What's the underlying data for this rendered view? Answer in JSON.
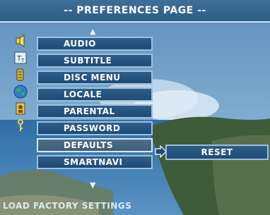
{
  "header": {
    "title": "-- PREFERENCES PAGE --"
  },
  "arrows": {
    "up": "▲",
    "down": "▼"
  },
  "menu": {
    "items": [
      {
        "label": "AUDIO",
        "icon": "speaker-icon"
      },
      {
        "label": "SUBTITLE",
        "icon": "subtitle-icon"
      },
      {
        "label": "DISC MENU",
        "icon": "disc-menu-icon"
      },
      {
        "label": "LOCALE",
        "icon": "globe-icon"
      },
      {
        "label": "PARENTAL",
        "icon": "parental-icon"
      },
      {
        "label": "PASSWORD",
        "icon": "key-icon"
      },
      {
        "label": "DEFAULTS",
        "icon": "defaults-icon",
        "selected": true
      },
      {
        "label": "SMARTNAVI",
        "icon": ""
      }
    ]
  },
  "submenu": {
    "option": "RESET"
  },
  "status": {
    "text": "LOAD FACTORY SETTINGS"
  },
  "colors": {
    "accent": "#2f5e8a",
    "border": "#9cc0df",
    "text": "#ffffff"
  }
}
